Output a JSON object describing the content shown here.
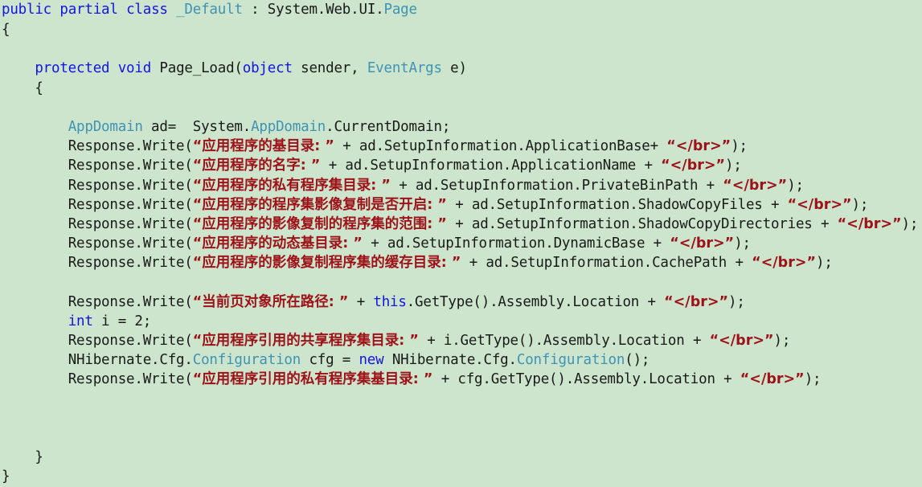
{
  "editor": {
    "background_color": "#cce5cc",
    "default_text_color": "#1a1a1a",
    "keyword_color": "#1414e6",
    "type_color": "#3f93b4",
    "string_color": "#9e1118",
    "language": "C#"
  },
  "lines": [
    {
      "id": "line-class-decl",
      "indent": 0,
      "tokens": [
        {
          "t": "public",
          "c": "kw"
        },
        {
          "t": " ",
          "c": "plain"
        },
        {
          "t": "partial",
          "c": "kw"
        },
        {
          "t": " ",
          "c": "plain"
        },
        {
          "t": "class",
          "c": "kw"
        },
        {
          "t": " ",
          "c": "plain"
        },
        {
          "t": "_Default",
          "c": "type"
        },
        {
          "t": " : System.Web.UI.",
          "c": "plain"
        },
        {
          "t": "Page",
          "c": "type"
        }
      ]
    },
    {
      "id": "line-class-open-brace",
      "indent": 0,
      "tokens": [
        {
          "t": "{",
          "c": "plain"
        }
      ]
    },
    {
      "id": "line-blank-1",
      "indent": 0,
      "tokens": [
        {
          "t": " ",
          "c": "plain"
        }
      ]
    },
    {
      "id": "line-page-load-signature",
      "indent": 4,
      "tokens": [
        {
          "t": "protected",
          "c": "kw"
        },
        {
          "t": " ",
          "c": "plain"
        },
        {
          "t": "void",
          "c": "kw"
        },
        {
          "t": " Page_Load(",
          "c": "plain"
        },
        {
          "t": "object",
          "c": "kw"
        },
        {
          "t": " sender, ",
          "c": "plain"
        },
        {
          "t": "EventArgs",
          "c": "type"
        },
        {
          "t": " e)",
          "c": "plain"
        }
      ]
    },
    {
      "id": "line-method-open-brace",
      "indent": 4,
      "tokens": [
        {
          "t": "{",
          "c": "plain"
        }
      ]
    },
    {
      "id": "line-blank-2",
      "indent": 0,
      "tokens": [
        {
          "t": " ",
          "c": "plain"
        }
      ]
    },
    {
      "id": "line-appdomain-var",
      "indent": 8,
      "tokens": [
        {
          "t": "AppDomain",
          "c": "type"
        },
        {
          "t": " ad=  System.",
          "c": "plain"
        },
        {
          "t": "AppDomain",
          "c": "type"
        },
        {
          "t": ".CurrentDomain;",
          "c": "plain"
        }
      ]
    },
    {
      "id": "line-write-application-base",
      "indent": 8,
      "tokens": [
        {
          "t": "Response.Write(",
          "c": "plain"
        },
        {
          "t": "“",
          "c": "strq"
        },
        {
          "t": "应用程序的基目录:",
          "c": "str"
        },
        {
          "t": " ”",
          "c": "strq"
        },
        {
          "t": " + ad.SetupInformation.ApplicationBase+ ",
          "c": "plain"
        },
        {
          "t": "“</br>”",
          "c": "str"
        },
        {
          "t": ");",
          "c": "plain"
        }
      ]
    },
    {
      "id": "line-write-application-name",
      "indent": 8,
      "tokens": [
        {
          "t": "Response.Write(",
          "c": "plain"
        },
        {
          "t": "“",
          "c": "strq"
        },
        {
          "t": "应用程序的名字:",
          "c": "str"
        },
        {
          "t": " ”",
          "c": "strq"
        },
        {
          "t": " + ad.SetupInformation.ApplicationName + ",
          "c": "plain"
        },
        {
          "t": "“</br>”",
          "c": "str"
        },
        {
          "t": ");",
          "c": "plain"
        }
      ]
    },
    {
      "id": "line-write-private-bin-path",
      "indent": 8,
      "tokens": [
        {
          "t": "Response.Write(",
          "c": "plain"
        },
        {
          "t": "“",
          "c": "strq"
        },
        {
          "t": "应用程序的私有程序集目录:",
          "c": "str"
        },
        {
          "t": " ”",
          "c": "strq"
        },
        {
          "t": " + ad.SetupInformation.PrivateBinPath + ",
          "c": "plain"
        },
        {
          "t": "“</br>”",
          "c": "str"
        },
        {
          "t": ");",
          "c": "plain"
        }
      ]
    },
    {
      "id": "line-write-shadow-copy-files",
      "indent": 8,
      "tokens": [
        {
          "t": "Response.Write(",
          "c": "plain"
        },
        {
          "t": "“",
          "c": "strq"
        },
        {
          "t": "应用程序的程序集影像复制是否开启:",
          "c": "str"
        },
        {
          "t": " ”",
          "c": "strq"
        },
        {
          "t": " + ad.SetupInformation.ShadowCopyFiles + ",
          "c": "plain"
        },
        {
          "t": "“</br>”",
          "c": "str"
        },
        {
          "t": ");",
          "c": "plain"
        }
      ]
    },
    {
      "id": "line-write-shadow-copy-directories",
      "indent": 8,
      "tokens": [
        {
          "t": "Response.Write(",
          "c": "plain"
        },
        {
          "t": "“",
          "c": "strq"
        },
        {
          "t": "应用程序的影像复制的程序集的范围:",
          "c": "str"
        },
        {
          "t": " ”",
          "c": "strq"
        },
        {
          "t": " + ad.SetupInformation.ShadowCopyDirectories + ",
          "c": "plain"
        },
        {
          "t": "“</br>”",
          "c": "str"
        },
        {
          "t": ");",
          "c": "plain"
        }
      ]
    },
    {
      "id": "line-write-dynamic-base",
      "indent": 8,
      "tokens": [
        {
          "t": "Response.Write(",
          "c": "plain"
        },
        {
          "t": "“",
          "c": "strq"
        },
        {
          "t": "应用程序的动态基目录:",
          "c": "str"
        },
        {
          "t": " ”",
          "c": "strq"
        },
        {
          "t": " + ad.SetupInformation.DynamicBase + ",
          "c": "plain"
        },
        {
          "t": "“</br>”",
          "c": "str"
        },
        {
          "t": ");",
          "c": "plain"
        }
      ]
    },
    {
      "id": "line-write-cache-path",
      "indent": 8,
      "tokens": [
        {
          "t": "Response.Write(",
          "c": "plain"
        },
        {
          "t": "“",
          "c": "strq"
        },
        {
          "t": "应用程序的影像复制程序集的缓存目录:",
          "c": "str"
        },
        {
          "t": " ”",
          "c": "strq"
        },
        {
          "t": " + ad.SetupInformation.CachePath + ",
          "c": "plain"
        },
        {
          "t": "“</br>”",
          "c": "str"
        },
        {
          "t": ");",
          "c": "plain"
        }
      ]
    },
    {
      "id": "line-blank-3",
      "indent": 0,
      "tokens": [
        {
          "t": " ",
          "c": "plain"
        }
      ]
    },
    {
      "id": "line-write-current-page-path",
      "indent": 8,
      "tokens": [
        {
          "t": "Response.Write(",
          "c": "plain"
        },
        {
          "t": "“",
          "c": "strq"
        },
        {
          "t": "当前页对象所在路径:",
          "c": "str"
        },
        {
          "t": " ”",
          "c": "strq"
        },
        {
          "t": " + ",
          "c": "plain"
        },
        {
          "t": "this",
          "c": "kw"
        },
        {
          "t": ".GetType().Assembly.Location + ",
          "c": "plain"
        },
        {
          "t": "“</br>”",
          "c": "str"
        },
        {
          "t": ");",
          "c": "plain"
        }
      ]
    },
    {
      "id": "line-int-i",
      "indent": 8,
      "tokens": [
        {
          "t": "int",
          "c": "kw"
        },
        {
          "t": " i = 2;",
          "c": "plain"
        }
      ]
    },
    {
      "id": "line-write-shared-assembly-dir",
      "indent": 8,
      "tokens": [
        {
          "t": "Response.Write(",
          "c": "plain"
        },
        {
          "t": "“",
          "c": "strq"
        },
        {
          "t": "应用程序引用的共享程序集目录:",
          "c": "str"
        },
        {
          "t": " ”",
          "c": "strq"
        },
        {
          "t": " + i.GetType().Assembly.Location + ",
          "c": "plain"
        },
        {
          "t": "“</br>”",
          "c": "str"
        },
        {
          "t": ");",
          "c": "plain"
        }
      ]
    },
    {
      "id": "line-nhibernate-config",
      "indent": 8,
      "tokens": [
        {
          "t": "NHibernate.Cfg.",
          "c": "plain"
        },
        {
          "t": "Configuration",
          "c": "type"
        },
        {
          "t": " cfg = ",
          "c": "plain"
        },
        {
          "t": "new",
          "c": "kw"
        },
        {
          "t": " NHibernate.Cfg.",
          "c": "plain"
        },
        {
          "t": "Configuration",
          "c": "type"
        },
        {
          "t": "();",
          "c": "plain"
        }
      ]
    },
    {
      "id": "line-write-private-assembly-base-dir",
      "indent": 8,
      "tokens": [
        {
          "t": "Response.Write(",
          "c": "plain"
        },
        {
          "t": "“",
          "c": "strq"
        },
        {
          "t": "应用程序引用的私有程序集基目录:",
          "c": "str"
        },
        {
          "t": " ”",
          "c": "strq"
        },
        {
          "t": " + cfg.GetType().Assembly.Location + ",
          "c": "plain"
        },
        {
          "t": "“</br>”",
          "c": "str"
        },
        {
          "t": ");",
          "c": "plain"
        }
      ]
    },
    {
      "id": "line-blank-4",
      "indent": 0,
      "tokens": [
        {
          "t": " ",
          "c": "plain"
        }
      ]
    },
    {
      "id": "line-blank-5",
      "indent": 0,
      "tokens": [
        {
          "t": " ",
          "c": "plain"
        }
      ]
    },
    {
      "id": "line-blank-6",
      "indent": 0,
      "tokens": [
        {
          "t": " ",
          "c": "plain"
        }
      ]
    },
    {
      "id": "line-method-close-brace",
      "indent": 4,
      "tokens": [
        {
          "t": "}",
          "c": "plain"
        }
      ]
    },
    {
      "id": "line-class-close-brace",
      "indent": 0,
      "tokens": [
        {
          "t": "}",
          "c": "plain"
        }
      ]
    }
  ]
}
